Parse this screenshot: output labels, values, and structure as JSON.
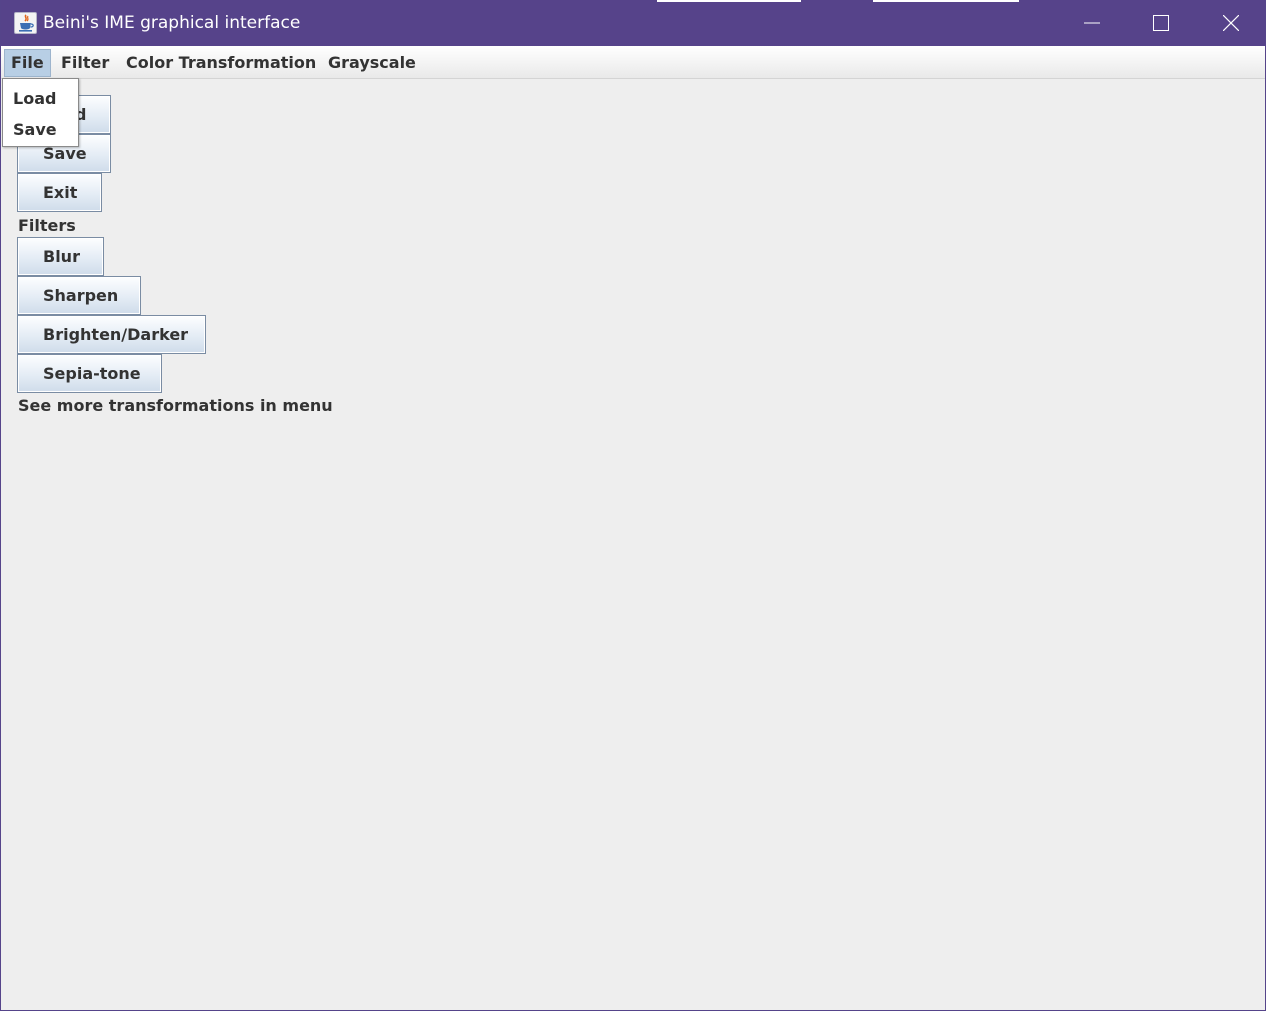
{
  "window": {
    "title": "Beini's IME graphical interface",
    "titlebar_color": "#56438a"
  },
  "menubar": {
    "items": [
      {
        "label": "File",
        "active": true
      },
      {
        "label": "Filter"
      },
      {
        "label": "Color Transformation"
      },
      {
        "label": "Grayscale"
      }
    ]
  },
  "file_menu": {
    "items": [
      {
        "label": "Load"
      },
      {
        "label": "Save"
      }
    ]
  },
  "file_section": {
    "buttons": [
      {
        "label": "Load"
      },
      {
        "label": "Save"
      },
      {
        "label": "Exit"
      }
    ]
  },
  "filters_section": {
    "heading": "Filters",
    "buttons": [
      {
        "label": "Blur"
      },
      {
        "label": "Sharpen"
      },
      {
        "label": "Brighten/Darker"
      },
      {
        "label": "Sepia-tone"
      }
    ]
  },
  "footer_note": "See more transformations in menu",
  "icons": {
    "app": "java-cup-icon",
    "minimize": "minimize-icon",
    "maximize": "maximize-icon",
    "close": "close-icon"
  }
}
